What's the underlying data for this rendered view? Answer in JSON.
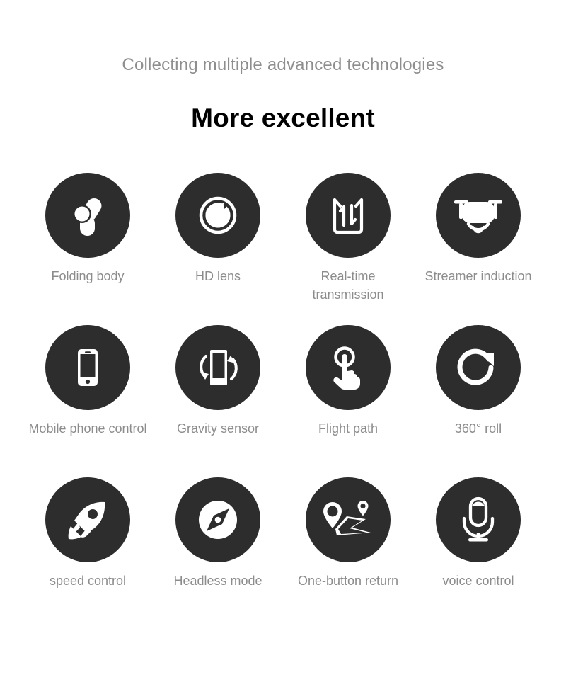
{
  "header": {
    "subtitle": "Collecting multiple advanced technologies",
    "title": "More excellent"
  },
  "theme": {
    "background": "#ffffff",
    "badge_color": "#2d2d2d",
    "icon_color": "#ffffff",
    "label_color": "#8c8c8c",
    "subtitle_color": "#8e8e8e",
    "title_color": "#000000"
  },
  "features": [
    {
      "label": "Folding body",
      "icon": "folding-body-icon"
    },
    {
      "label": "HD lens",
      "icon": "hd-lens-icon"
    },
    {
      "label": "Real-time transmission",
      "icon": "real-time-transmission-icon"
    },
    {
      "label": "Streamer induction",
      "icon": "streamer-induction-icon"
    },
    {
      "label": "Mobile phone control",
      "icon": "mobile-phone-icon"
    },
    {
      "label": "Gravity sensor",
      "icon": "gravity-sensor-icon"
    },
    {
      "label": "Flight path",
      "icon": "flight-path-hand-icon"
    },
    {
      "label": "360° roll",
      "icon": "rotate-360-icon"
    },
    {
      "label": "speed control",
      "icon": "rocket-icon"
    },
    {
      "label": "Headless mode",
      "icon": "compass-icon"
    },
    {
      "label": "One-button return",
      "icon": "map-route-pins-icon"
    },
    {
      "label": "voice control",
      "icon": "microphone-icon"
    }
  ]
}
